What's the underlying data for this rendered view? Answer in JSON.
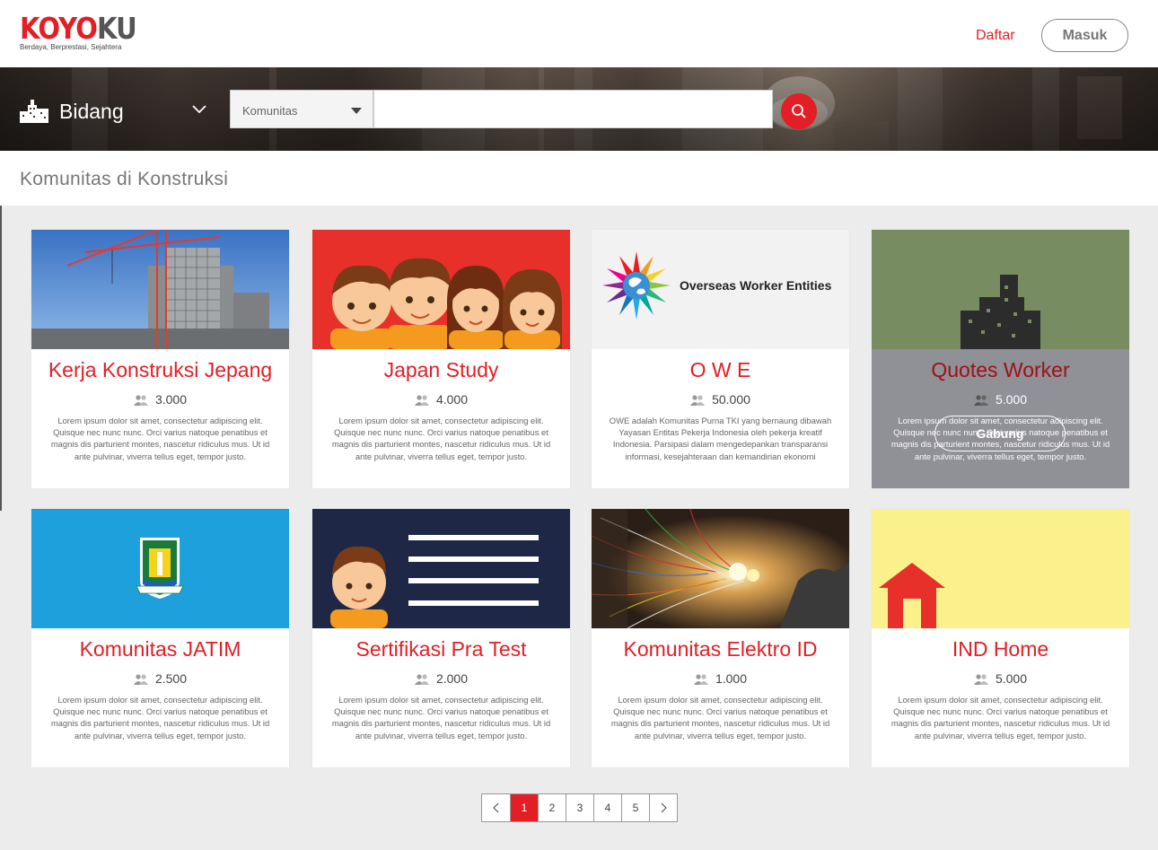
{
  "header": {
    "logo_part1": "KOYO",
    "logo_part2": "KU",
    "tagline": "Berdaya, Berprestasi, Sejahtera",
    "register_label": "Daftar",
    "login_label": "Masuk"
  },
  "search": {
    "category_label": "Bidang",
    "dropdown_value": "Komunitas",
    "query_value": ""
  },
  "section_title": "Komunitas di Konstruksi",
  "cards": [
    {
      "title": "Kerja Konstruksi Jepang",
      "members": "3.000",
      "desc": "Lorem ipsum dolor sit amet, consectetur adipiscing elit. Quisque nec nunc nunc. Orci varius natoque penatibus et magnis dis parturient montes, nascetur ridiculus mus. Ut id ante pulvinar, viverra tellus eget, tempor justo."
    },
    {
      "title": "Japan Study",
      "members": "4.000",
      "desc": "Lorem ipsum dolor sit amet, consectetur adipiscing elit. Quisque nec nunc nunc. Orci varius natoque penatibus et magnis dis parturient montes, nascetur ridiculus mus. Ut id ante pulvinar, viverra tellus eget, tempor justo."
    },
    {
      "title": "O W E",
      "members": "50.000",
      "desc": "OWE adalah Komunitas Purna TKI yang bernaung dibawah Yayasan Entitas Pekerja Indonesia oleh pekerja kreatif Indonesia.  Parsipasi dalam mengedepankan transparansi informasi, kesejahteraan dan kemandirian ekonomi",
      "logo_text": "Overseas Worker Entities"
    },
    {
      "title": "Quotes Worker",
      "members": "5.000",
      "desc": "Lorem ipsum dolor sit amet, consectetur adipiscing elit. Quisque nec nunc nunc. Orci varius natoque penatibus et magnis dis parturient montes, nascetur ridiculus mus. Ut id ante pulvinar, viverra tellus eget, tempor justo.",
      "join_label": "Gabung"
    },
    {
      "title": "Komunitas JATIM",
      "members": "2.500",
      "desc": "Lorem ipsum dolor sit amet, consectetur adipiscing elit. Quisque nec nunc nunc. Orci varius natoque penatibus et magnis dis parturient montes, nascetur ridiculus mus. Ut id ante pulvinar, viverra tellus eget, tempor justo."
    },
    {
      "title": "Sertifikasi Pra Test",
      "members": "2.000",
      "desc": "Lorem ipsum dolor sit amet, consectetur adipiscing elit. Quisque nec nunc nunc. Orci varius natoque penatibus et magnis dis parturient montes, nascetur ridiculus mus. Ut id ante pulvinar, viverra tellus eget, tempor justo."
    },
    {
      "title": "Komunitas Elektro ID",
      "members": "1.000",
      "desc": "Lorem ipsum dolor sit amet, consectetur adipiscing elit. Quisque nec nunc nunc. Orci varius natoque penatibus et magnis dis parturient montes, nascetur ridiculus mus. Ut id ante pulvinar, viverra tellus eget, tempor justo."
    },
    {
      "title": "IND Home",
      "members": "5.000",
      "desc": "Lorem ipsum dolor sit amet, consectetur adipiscing elit. Quisque nec nunc nunc. Orci varius natoque penatibus et magnis dis parturient montes, nascetur ridiculus mus. Ut id ante pulvinar, viverra tellus eget, tempor justo."
    }
  ],
  "pagination": {
    "pages": [
      "1",
      "2",
      "3",
      "4",
      "5"
    ],
    "current": "1",
    "prev_icon": "chevron-left-icon",
    "next_icon": "chevron-right-icon"
  },
  "colors": {
    "brand_red": "#e31e24",
    "card_bg_olive": "#788c62",
    "card_bg_blue": "#1ea0dc",
    "card_bg_navy": "#1e2846",
    "card_bg_yellow": "#faf08c"
  }
}
